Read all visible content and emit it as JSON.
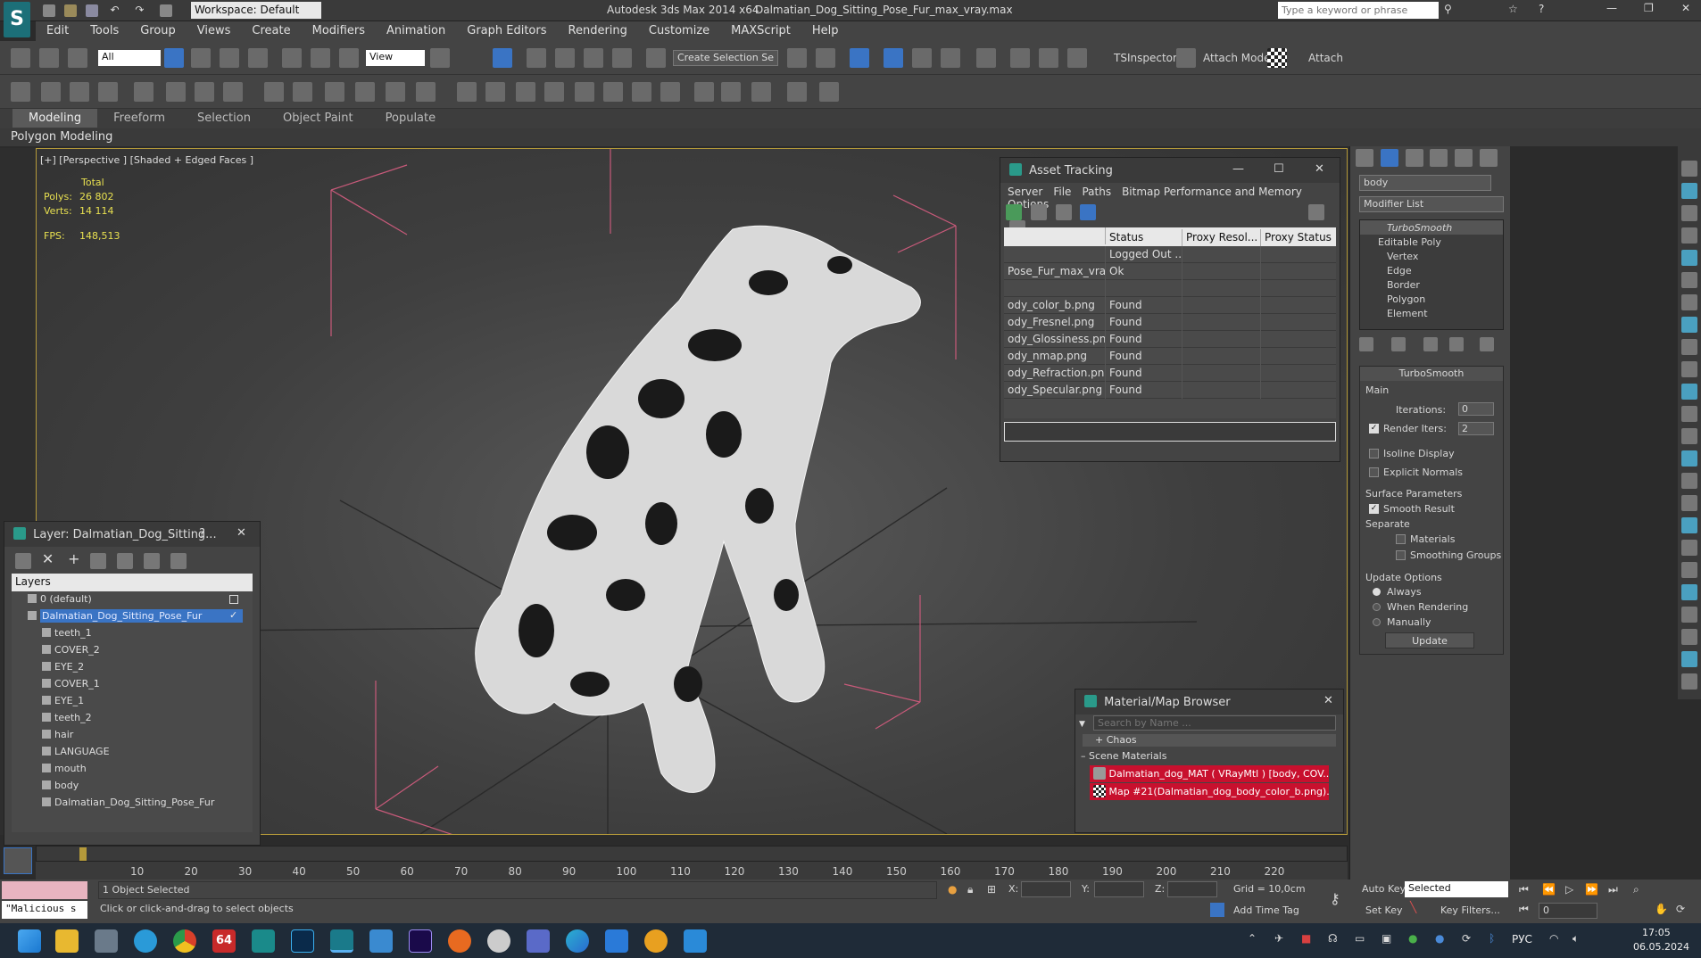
{
  "titlebar": {
    "workspace": "Workspace: Default",
    "app": "Autodesk 3ds Max  2014 x64",
    "file": "Dalmatian_Dog_Sitting_Pose_Fur_max_vray.max",
    "search_placeholder": "Type a keyword or phrase"
  },
  "menu": [
    "Edit",
    "Tools",
    "Group",
    "Views",
    "Create",
    "Modifiers",
    "Animation",
    "Graph Editors",
    "Rendering",
    "Customize",
    "MAXScript",
    "Help"
  ],
  "toolbar": {
    "filter": "All",
    "refcoord": "View",
    "selection_set": "Create Selection Se",
    "tsinspector": "TSInspector",
    "attach_mode": "Attach Mode",
    "attach": "Attach"
  },
  "ribbon": {
    "tabs": [
      "Modeling",
      "Freeform",
      "Selection",
      "Object Paint",
      "Populate"
    ],
    "sub": "Polygon Modeling"
  },
  "viewport": {
    "label": "[+] [Perspective ] [Shaded + Edged Faces ]",
    "total": "Total",
    "polys_label": "Polys:",
    "polys": "26 802",
    "verts_label": "Verts:",
    "verts": "14 114",
    "fps_label": "FPS:",
    "fps": "148,513"
  },
  "asset": {
    "title": "Asset Tracking",
    "menu": [
      "Server",
      "File",
      "Paths",
      "Bitmap Performance and Memory",
      "Options"
    ],
    "cols": [
      "Status",
      "Proxy Resol...",
      "Proxy Status"
    ],
    "rows": [
      {
        "name": "",
        "status": "Logged Out ..."
      },
      {
        "name": "Pose_Fur_max_vray...",
        "status": "Ok"
      },
      {
        "name": "",
        "status": ""
      },
      {
        "name": "ody_color_b.png",
        "status": "Found"
      },
      {
        "name": "ody_Fresnel.png",
        "status": "Found"
      },
      {
        "name": "ody_Glossiness.png",
        "status": "Found"
      },
      {
        "name": "ody_nmap.png",
        "status": "Found"
      },
      {
        "name": "ody_Refraction.png",
        "status": "Found"
      },
      {
        "name": "ody_Specular.png",
        "status": "Found"
      }
    ]
  },
  "layer": {
    "title": "Layer: Dalmatian_Dog_Sitting...",
    "help": "?",
    "header": "Layers",
    "items": [
      "0 (default)",
      "Dalmatian_Dog_Sitting_Pose_Fur",
      "teeth_1",
      "COVER_2",
      "EYE_2",
      "COVER_1",
      "EYE_1",
      "teeth_2",
      "hair",
      "LANGUAGE",
      "mouth",
      "body",
      "Dalmatian_Dog_Sitting_Pose_Fur"
    ]
  },
  "matbrowser": {
    "title": "Material/Map Browser",
    "search": "Search by Name ...",
    "chaos": "+ Chaos",
    "scene": "Scene Materials",
    "items": [
      "Dalmatian_dog_MAT ( VRayMtl ) [body, COV...",
      "Map #21(Dalmatian_dog_body_color_b.png)..."
    ]
  },
  "cmdpanel": {
    "object": "body",
    "modlist": "Modifier List",
    "stack": [
      "TurboSmooth",
      "Editable Poly",
      "Vertex",
      "Edge",
      "Border",
      "Polygon",
      "Element"
    ],
    "rollout": "TurboSmooth",
    "main": "Main",
    "iter_label": "Iterations:",
    "iter": "0",
    "render_iters_label": "Render Iters:",
    "render_iters": "2",
    "isoline": "Isoline Display",
    "explicit": "Explicit Normals",
    "surface": "Surface Parameters",
    "smooth": "Smooth Result",
    "separate": "Separate",
    "materials": "Materials",
    "smoothing": "Smoothing Groups",
    "update_opts": "Update Options",
    "always": "Always",
    "when_rendering": "When Rendering",
    "manually": "Manually",
    "update": "Update"
  },
  "timeline": {
    "ticks": [
      "10",
      "20",
      "30",
      "40",
      "50",
      "60",
      "70",
      "80",
      "90",
      "100",
      "110",
      "120",
      "130",
      "140",
      "150",
      "160",
      "170",
      "180",
      "190",
      "200",
      "210",
      "220"
    ]
  },
  "status": {
    "maxscript": "\"Malicious s",
    "selected": "1 Object Selected",
    "prompt": "Click or click-and-drag to select objects",
    "x": "X:",
    "y": "Y:",
    "z": "Z:",
    "grid": "Grid = 10,0cm",
    "addtime": "Add Time Tag",
    "autokey": "Auto Key",
    "autokey_val": "Selected",
    "setkey": "Set Key",
    "keyfilters": "Key Filters...",
    "frame": "0"
  },
  "taskbar": {
    "lang": "РУС",
    "time": "17:05",
    "date": "06.05.2024",
    "badge": "64"
  },
  "colors": {
    "accent": "#3a74c4",
    "viewport_border": "#b59a3a",
    "red_item": "#c8102e"
  }
}
